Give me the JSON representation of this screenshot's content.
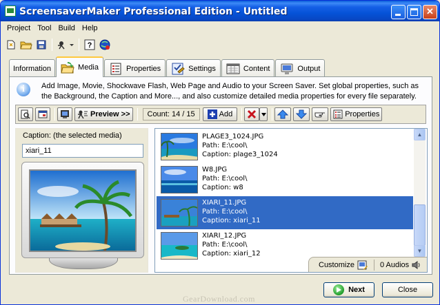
{
  "window": {
    "title": "ScreensaverMaker Professional Edition - Untitled"
  },
  "menu": {
    "items": [
      "Project",
      "Tool",
      "Build",
      "Help"
    ]
  },
  "toolbar": {
    "icons": [
      "new-project-icon",
      "open-folder-icon",
      "save-icon",
      "wizard-icon",
      "help-icon",
      "web-icon"
    ]
  },
  "tabs": [
    {
      "label": "Information",
      "icon": "none"
    },
    {
      "label": "Media",
      "icon": "folder-icon",
      "active": true
    },
    {
      "label": "Properties",
      "icon": "properties-icon"
    },
    {
      "label": "Settings",
      "icon": "settings-icon"
    },
    {
      "label": "Content",
      "icon": "content-icon"
    },
    {
      "label": "Output",
      "icon": "output-icon"
    }
  ],
  "info": {
    "text": "Add Image, Movie, Shockwave Flash, Web Page and Audio to your Screen Saver. Set global properties, such as the Background, the Caption and More..., and also customize detailed media properties for every file separately."
  },
  "media_toolbar": {
    "preview_label": "Preview >>",
    "count_label": "Count: 14 / 15",
    "add_label": "Add",
    "properties_label": "Properties"
  },
  "caption": {
    "label": "Caption: (the selected media)",
    "value": "xiari_11"
  },
  "media_items": [
    {
      "name": "PLAGE3_1024.JPG",
      "path": "Path: E:\\cool\\",
      "caption": "Caption: plage3_1024",
      "selected": false
    },
    {
      "name": "W8.JPG",
      "path": "Path: E:\\cool\\",
      "caption": "Caption: w8",
      "selected": false
    },
    {
      "name": "XIARI_11.JPG",
      "path": "Path: E:\\cool\\",
      "caption": "Caption: xiari_11",
      "selected": true
    },
    {
      "name": "XIARI_12.JPG",
      "path": "Path: E:\\cool\\",
      "caption": "Caption: xiari_12",
      "selected": false
    }
  ],
  "list_footer": {
    "customize_label": "Customize",
    "audios_label": "0 Audios"
  },
  "buttons": {
    "next_label": "Next",
    "close_label": "Close"
  },
  "watermark": "GearDownload.com",
  "colors": {
    "titlebar": "#0553d8",
    "selection": "#316ac5",
    "window_bg": "#ece9d8"
  }
}
